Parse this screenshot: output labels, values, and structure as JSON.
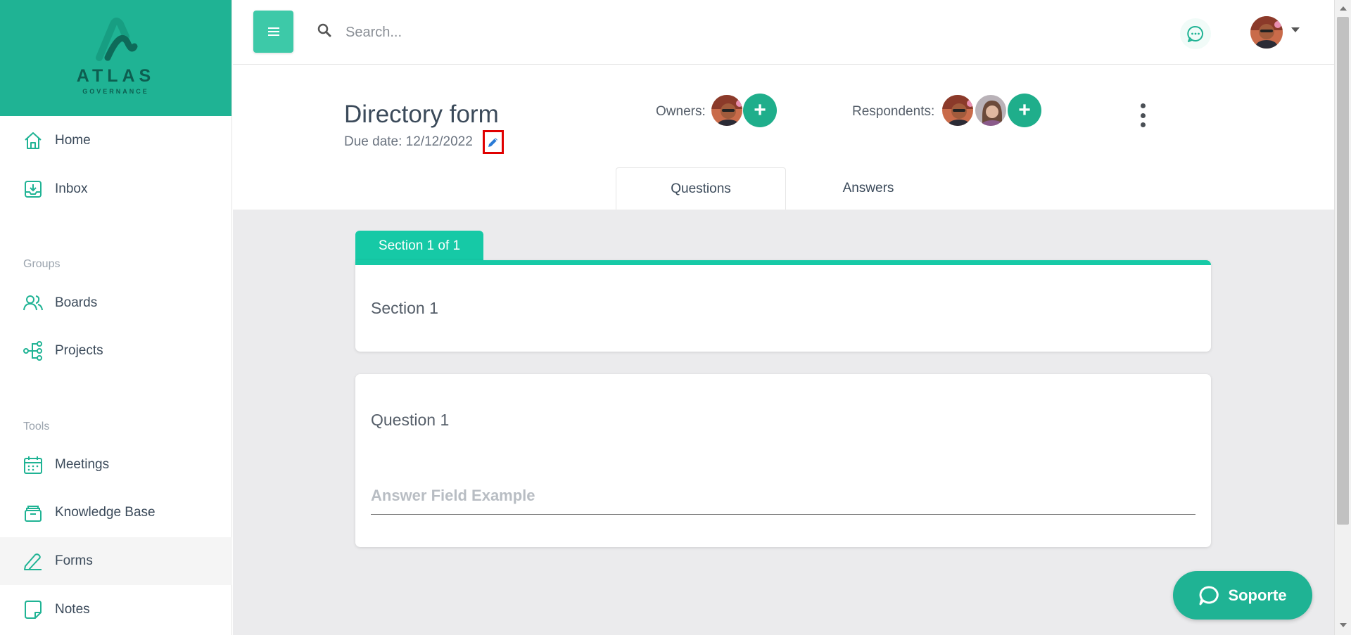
{
  "brand": {
    "name": "ATLAS",
    "tagline": "GOVERNANCE",
    "accent_color": "#1fb394"
  },
  "sidebar": {
    "items": [
      {
        "label": "Home",
        "icon": "home-icon"
      },
      {
        "label": "Inbox",
        "icon": "inbox-icon"
      },
      {
        "label": "Boards",
        "icon": "users-icon"
      },
      {
        "label": "Projects",
        "icon": "project-tree-icon"
      },
      {
        "label": "Meetings",
        "icon": "calendar-icon"
      },
      {
        "label": "Knowledge Base",
        "icon": "archive-icon"
      },
      {
        "label": "Forms",
        "icon": "pen-icon",
        "active": true
      },
      {
        "label": "Notes",
        "icon": "note-icon"
      }
    ],
    "sections": {
      "groups": "Groups",
      "tools": "Tools"
    }
  },
  "topbar": {
    "search_placeholder": "Search..."
  },
  "form": {
    "title": "Directory form",
    "due_date": "Due date: 12/12/2022",
    "owners_label": "Owners:",
    "respondents_label": "Respondents:",
    "add_symbol": "+"
  },
  "tabs": [
    {
      "label": "Questions",
      "active": true
    },
    {
      "label": "Answers",
      "active": false
    }
  ],
  "content": {
    "section_tab": "Section 1 of 1",
    "section_title": "Section 1",
    "question_title": "Question 1",
    "answer_placeholder": "Answer Field Example"
  },
  "support": {
    "label": "Soporte"
  }
}
